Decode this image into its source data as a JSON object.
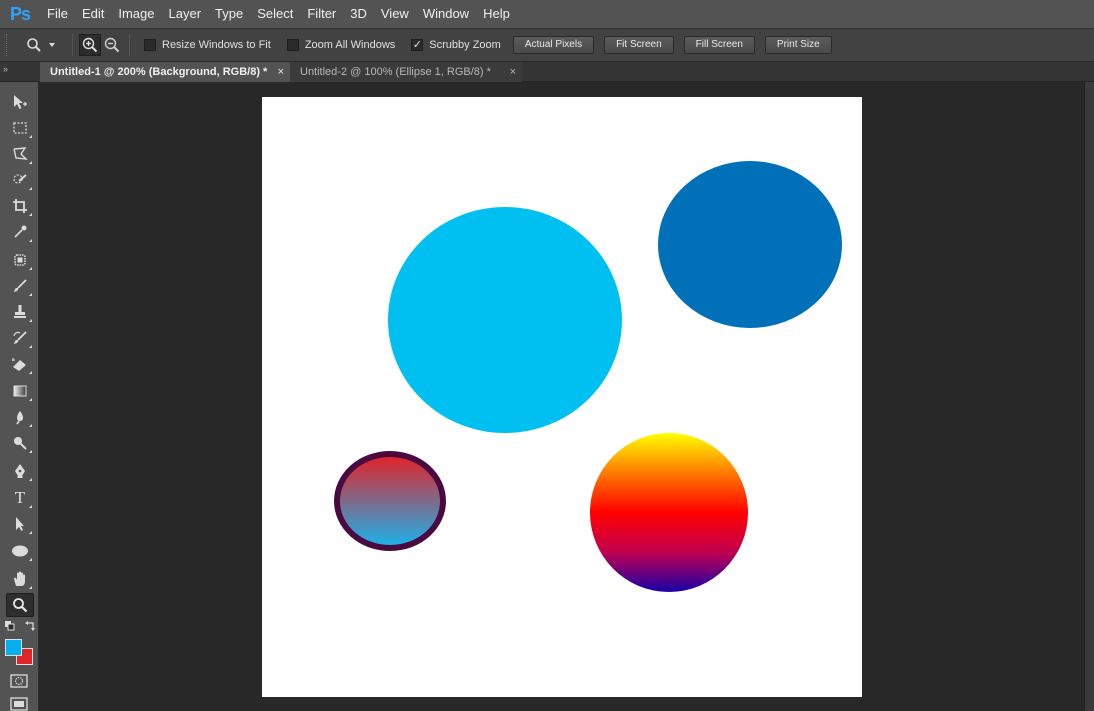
{
  "app": {
    "logo": "Ps"
  },
  "menu": [
    "File",
    "Edit",
    "Image",
    "Layer",
    "Type",
    "Select",
    "Filter",
    "3D",
    "View",
    "Window",
    "Help"
  ],
  "options": {
    "tool_icon": "zoom-icon",
    "zoom_in_icon": "zoom-in-icon",
    "zoom_out_icon": "zoom-out-icon",
    "checkboxes": [
      {
        "label": "Resize Windows to Fit",
        "checked": false
      },
      {
        "label": "Zoom All Windows",
        "checked": false
      },
      {
        "label": "Scrubby Zoom",
        "checked": true
      }
    ],
    "check_mark": "✓",
    "buttons": [
      "Actual Pixels",
      "Fit Screen",
      "Fill Screen",
      "Print Size"
    ]
  },
  "tabs": [
    {
      "title": "Untitled-1 @ 200% (Background, RGB/8) *",
      "active": true
    },
    {
      "title": "Untitled-2 @ 100% (Ellipse 1, RGB/8) *",
      "active": false
    }
  ],
  "tab_close": "×",
  "panel_collapse": "»",
  "tools": [
    "move-tool",
    "marquee-tool",
    "lasso-tool",
    "quick-selection-tool",
    "crop-tool",
    "eyedropper-tool",
    "healing-brush-tool",
    "brush-tool",
    "clone-stamp-tool",
    "history-brush-tool",
    "eraser-tool",
    "gradient-tool",
    "blur-tool",
    "dodge-tool",
    "pen-tool",
    "type-tool",
    "path-selection-tool",
    "ellipse-tool",
    "hand-tool",
    "zoom-tool"
  ],
  "type_tool_glyph": "T",
  "colors": {
    "foreground": "#00b0f0",
    "background": "#e0242a",
    "canvas": "#ffffff",
    "shapes": {
      "cyan_circle": "#00c0f2",
      "blue_ellipse": "#0070b9",
      "small_ellipse_gradient": [
        "#e0242a",
        "#1eb0e8"
      ],
      "small_ellipse_stroke": "#4b0a3f",
      "spectrum_gradient": [
        "#ffff00",
        "#ff7a00",
        "#ff0000",
        "#c00050",
        "#1a00a8"
      ]
    }
  }
}
